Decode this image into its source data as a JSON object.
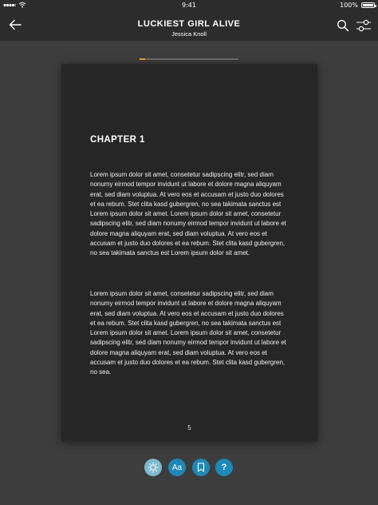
{
  "status_bar": {
    "time": "9:41",
    "battery_text": "100%",
    "battery_level": 1.0
  },
  "header": {
    "title": "LUCKIEST GIRL ALIVE",
    "author": "Jessica Knoll",
    "icons": [
      "back-arrow-icon",
      "search-icon",
      "sliders-icon"
    ]
  },
  "progress": {
    "fraction": 0.06,
    "color": "#f2a31a"
  },
  "page": {
    "chapter_title": "CHAPTER 1",
    "paragraphs": [
      "Lorem ipsum dolor sit amet, consetetur sadipscing elitr, sed diam nonumy eirmod tempor invidunt ut labore et dolore magna aliquyam erat, sed diam voluptua. At vero eos et accusam et justo duo dolores et ea rebum. Stet clita kasd gubergren, no sea takimata sanctus est Lorem ipsum dolor sit amet. Lorem ipsum dolor sit amet, consetetur sadipscing elitr, sed diam nonumy eirmod tempor invidunt ut labore et dolore magna aliquyam erat, sed diam voluptua. At vero eos et accusam et justo duo dolores et ea rebum. Stet clita kasd gubergren, no sea takimata sanctus est Lorem ipsum dolor sit amet.",
      "Lorem ipsum dolor sit amet, consetetur sadipscing elitr, sed diam nonumy eirmod tempor invidunt ut labore et dolore magna aliquyam erat, sed diam voluptua. At vero eos et accusam et justo duo dolores et ea rebum. Stet clita kasd gubergren, no sea takimata sanctus est Lorem ipsum dolor sit amet. Lorem ipsum dolor sit amet, consetetur sadipscing elitr, sed diam nonumy eirmod tempor invidunt ut labore et dolore magna aliquyam erat, sed diam voluptua. At vero eos et accusam et justo duo dolores et ea rebum. Stet clita kasd gubergren, no sea."
    ],
    "page_number": "5"
  },
  "toolbar": {
    "font_label": "Aa",
    "help_label": "?",
    "accent_color": "#1e88b6",
    "active_color": "#7fb9cf",
    "icons": [
      "brightness-icon",
      "font-size-icon",
      "bookmark-icon",
      "help-icon"
    ]
  }
}
